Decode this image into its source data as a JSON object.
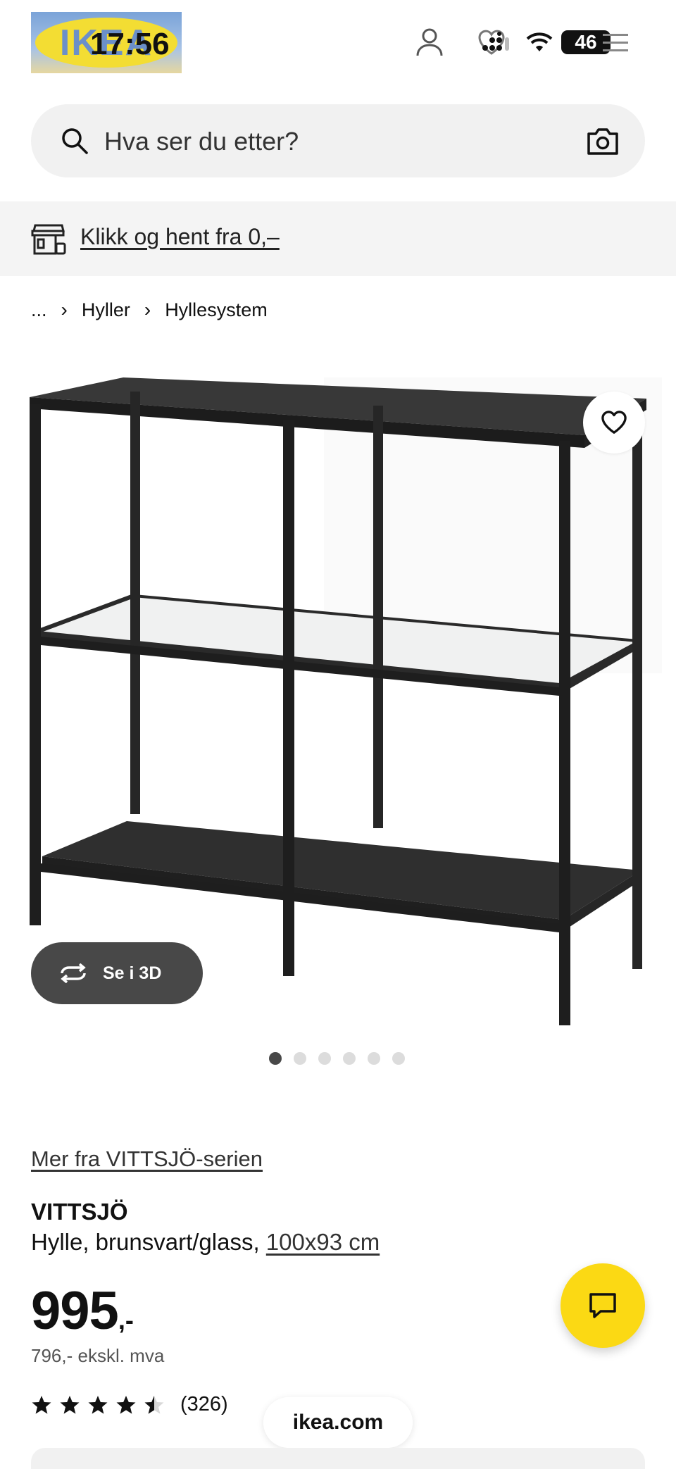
{
  "status_bar": {
    "time": "17:56",
    "battery": "46"
  },
  "header": {
    "logo_text": "IKEA"
  },
  "search": {
    "placeholder": "Hva ser du etter?"
  },
  "banner": {
    "link_text": "Klikk og hent fra 0,–"
  },
  "breadcrumb": {
    "ellipsis": "...",
    "items": [
      "Hyller",
      "Hyllesystem"
    ]
  },
  "media": {
    "view3d_label": "Se i 3D",
    "image_count": 6,
    "active_index": 0
  },
  "product": {
    "series_link": "Mer fra VITTSJÖ-serien",
    "name": "VITTSJÖ",
    "description": "Hylle, brunsvart/glass,",
    "size": "100x93 cm",
    "price": "995",
    "price_suffix": ",-",
    "price_ex_vat": "796,- ekskl. mva",
    "rating": 4.5,
    "review_count": "(326)"
  },
  "browser": {
    "url": "ikea.com"
  },
  "colors": {
    "accent_yellow": "#fbd914",
    "dark_button": "#484848",
    "surface_grey": "#f1f1f1"
  },
  "icons": [
    "user-icon",
    "heart-icon",
    "menu-icon",
    "search-icon",
    "camera-icon",
    "store-icon",
    "rotate-3d-icon",
    "chat-icon",
    "star-icon"
  ]
}
